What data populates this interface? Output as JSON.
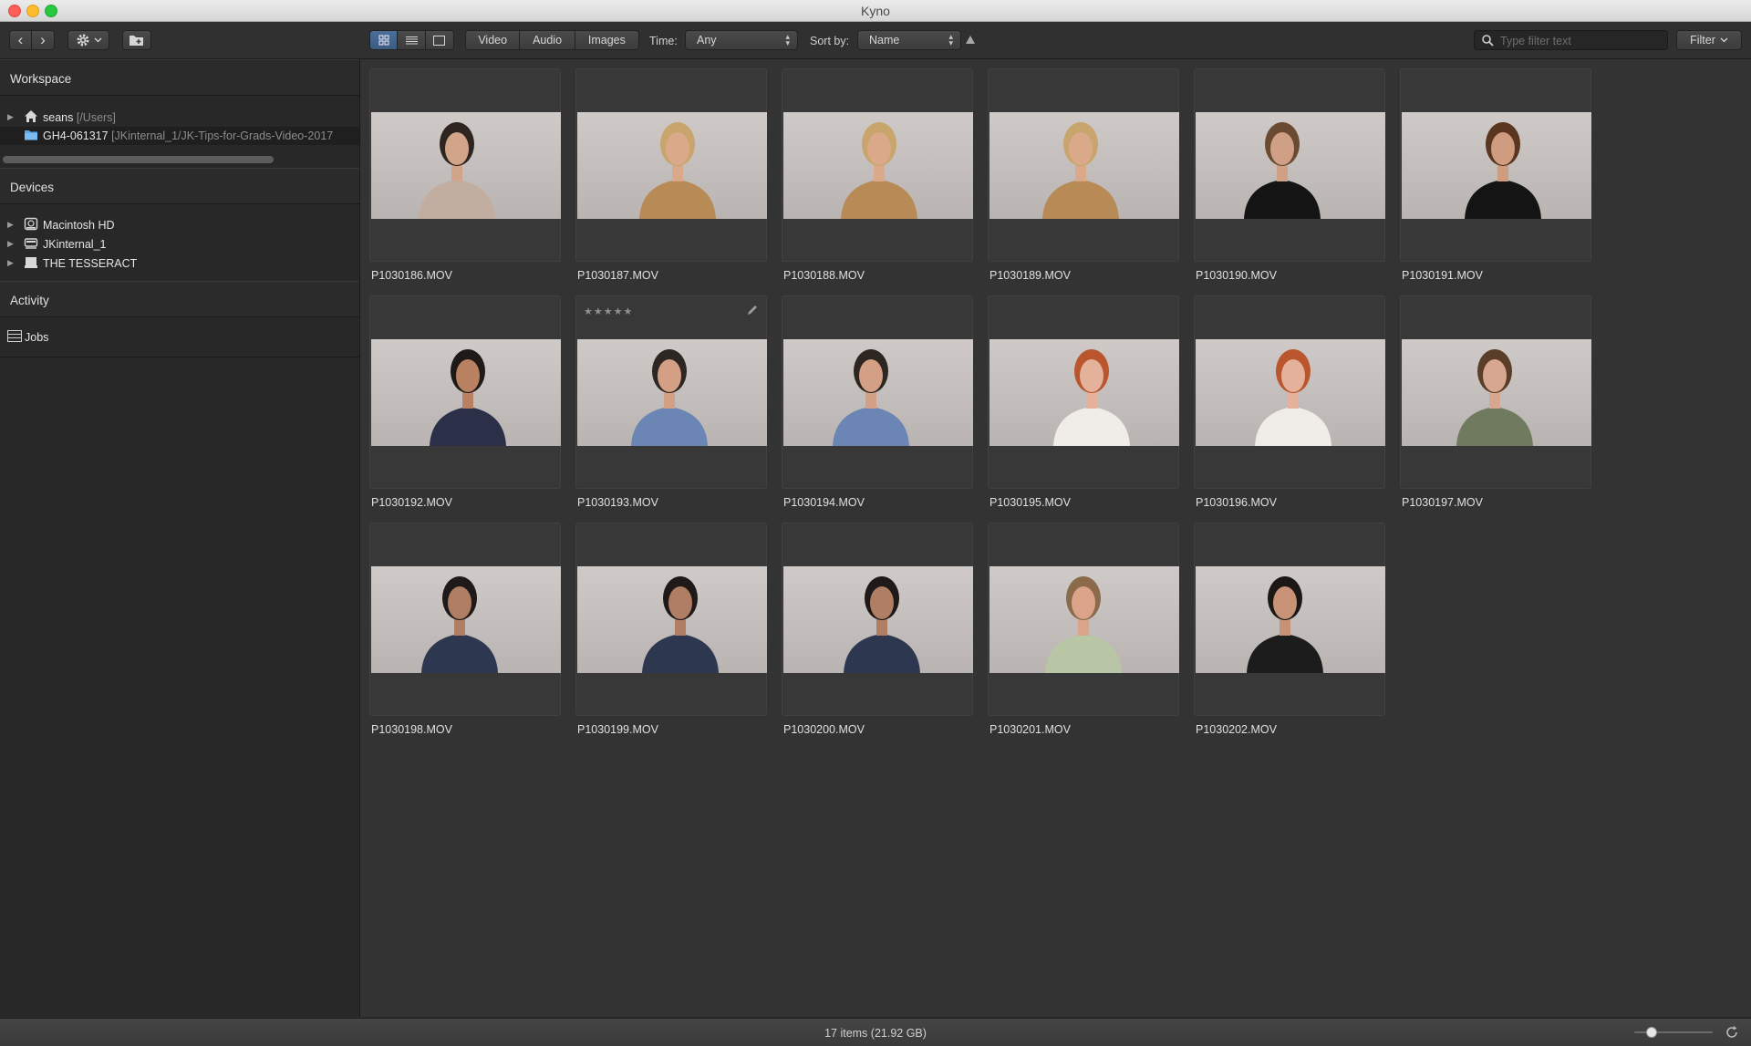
{
  "window": {
    "title": "Kyno"
  },
  "toolbar": {
    "nav_back": "‹",
    "nav_forward": "›",
    "view_modes": [
      "grid",
      "list",
      "single"
    ],
    "type_filters": [
      "Video",
      "Audio",
      "Images"
    ],
    "time_label": "Time:",
    "time_value": "Any",
    "sort_label": "Sort by:",
    "sort_value": "Name",
    "search_placeholder": "Type filter text",
    "filter_label": "Filter"
  },
  "sidebar": {
    "workspace_title": "Workspace",
    "workspace_items": [
      {
        "name": "seans",
        "path": "[/Users]",
        "icon": "home-icon"
      },
      {
        "name": "GH4-061317",
        "path": "[JKinternal_1/JK-Tips-for-Grads-Video-2017",
        "icon": "folder-icon"
      }
    ],
    "devices_title": "Devices",
    "devices": [
      {
        "name": "Macintosh HD",
        "icon": "hard-drive-icon"
      },
      {
        "name": "JKinternal_1",
        "icon": "external-drive-icon"
      },
      {
        "name": "THE TESSERACT",
        "icon": "external-drive-icon"
      }
    ],
    "activity_title": "Activity",
    "jobs_label": "Jobs"
  },
  "grid": {
    "items": [
      {
        "name": "P1030186.MOV",
        "rating": "",
        "shirt": "#c2aea0",
        "skin": "#d2a58b",
        "hair": "#2e2420"
      },
      {
        "name": "P1030187.MOV",
        "rating": "",
        "shirt": "#b88a55",
        "skin": "#d9a98a",
        "hair": "#c9a56e"
      },
      {
        "name": "P1030188.MOV",
        "rating": "",
        "shirt": "#b88a55",
        "skin": "#d9a98a",
        "hair": "#c9a56e"
      },
      {
        "name": "P1030189.MOV",
        "rating": "",
        "shirt": "#b88a55",
        "skin": "#d9a98a",
        "hair": "#c9a56e"
      },
      {
        "name": "P1030190.MOV",
        "rating": "",
        "shirt": "#141414",
        "skin": "#cf9f86",
        "hair": "#6a4a30"
      },
      {
        "name": "P1030191.MOV",
        "rating": "",
        "shirt": "#141414",
        "skin": "#cf9c80",
        "hair": "#5a3520"
      },
      {
        "name": "P1030192.MOV",
        "rating": "",
        "shirt": "#2c2f48",
        "skin": "#b98062",
        "hair": "#1e1a18"
      },
      {
        "name": "P1030193.MOV",
        "rating": "★★★★★",
        "shirt": "#6b85b5",
        "skin": "#d3a086",
        "hair": "#2e2620"
      },
      {
        "name": "P1030194.MOV",
        "rating": "",
        "shirt": "#6b85b5",
        "skin": "#d3a086",
        "hair": "#2e2620"
      },
      {
        "name": "P1030195.MOV",
        "rating": "",
        "shirt": "#f0ede8",
        "skin": "#e4b29a",
        "hair": "#b9562e"
      },
      {
        "name": "P1030196.MOV",
        "rating": "",
        "shirt": "#f0ede8",
        "skin": "#e4b29a",
        "hair": "#b9562e"
      },
      {
        "name": "P1030197.MOV",
        "rating": "",
        "shirt": "#707a5e",
        "skin": "#d7a790",
        "hair": "#5a3e2a"
      },
      {
        "name": "P1030198.MOV",
        "rating": "",
        "shirt": "#2d3850",
        "skin": "#b07e64",
        "hair": "#1f1a18"
      },
      {
        "name": "P1030199.MOV",
        "rating": "",
        "shirt": "#2d3850",
        "skin": "#b07e64",
        "hair": "#1f1a18"
      },
      {
        "name": "P1030200.MOV",
        "rating": "",
        "shirt": "#2d3850",
        "skin": "#b07e64",
        "hair": "#1f1a18"
      },
      {
        "name": "P1030201.MOV",
        "rating": "",
        "shirt": "#b9c6a5",
        "skin": "#dba489",
        "hair": "#8a6a4a"
      },
      {
        "name": "P1030202.MOV",
        "rating": "",
        "shirt": "#1c1c1c",
        "skin": "#c89276",
        "hair": "#1c1816"
      }
    ]
  },
  "status": {
    "summary": "17 items (21.92 GB)"
  }
}
